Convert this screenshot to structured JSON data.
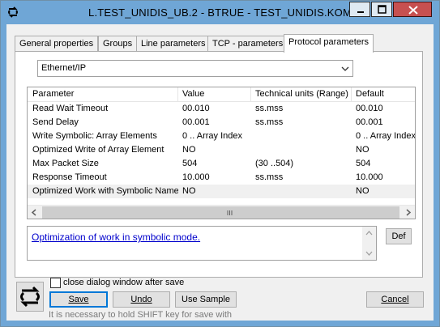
{
  "window": {
    "title": "L.TEST_UNIDIS_UB.2 - BTRUE - TEST_UNIDIS.KOM"
  },
  "tabs": [
    {
      "label": "General properties",
      "active": false
    },
    {
      "label": "Groups",
      "active": false
    },
    {
      "label": "Line parameters",
      "active": false
    },
    {
      "label": "TCP - parameters",
      "active": false
    },
    {
      "label": "Protocol parameters",
      "active": true
    }
  ],
  "protocol": {
    "selected": "Ethernet/IP"
  },
  "table": {
    "headers": [
      "Parameter",
      "Value",
      "Technical units (Range)",
      "Default"
    ],
    "rows": [
      [
        "Read Wait Timeout",
        "00.010",
        "ss.mss",
        "00.010"
      ],
      [
        "Send Delay",
        "00.001",
        "ss.mss",
        "00.001"
      ],
      [
        "Write Symbolic: Array Elements",
        "0 .. Array Index",
        "",
        "0 .. Array Index"
      ],
      [
        "Optimized Write of Array Element",
        "NO",
        "",
        "NO"
      ],
      [
        "Max Packet Size",
        "504",
        "(30 ..504)",
        "504"
      ],
      [
        "Response Timeout",
        "10.000",
        "ss.mss",
        "10.000"
      ],
      [
        "Optimized Work with Symbolic Names",
        "NO",
        "",
        "NO"
      ]
    ],
    "highlighted_row": 6
  },
  "description": {
    "text": "Optimization of work in symbolic mode."
  },
  "buttons": {
    "def": "Def",
    "save": "Save",
    "undo": "Undo",
    "use_sample": "Use Sample",
    "cancel": "Cancel"
  },
  "checkbox": {
    "label": "close dialog window after save",
    "checked": false
  },
  "hint": "It is necessary to hold SHIFT key for save with",
  "colors": {
    "titlebar": "#6fa6d6",
    "close_button": "#c75050",
    "link": "#0000cc",
    "focus_border": "#0078d7"
  }
}
